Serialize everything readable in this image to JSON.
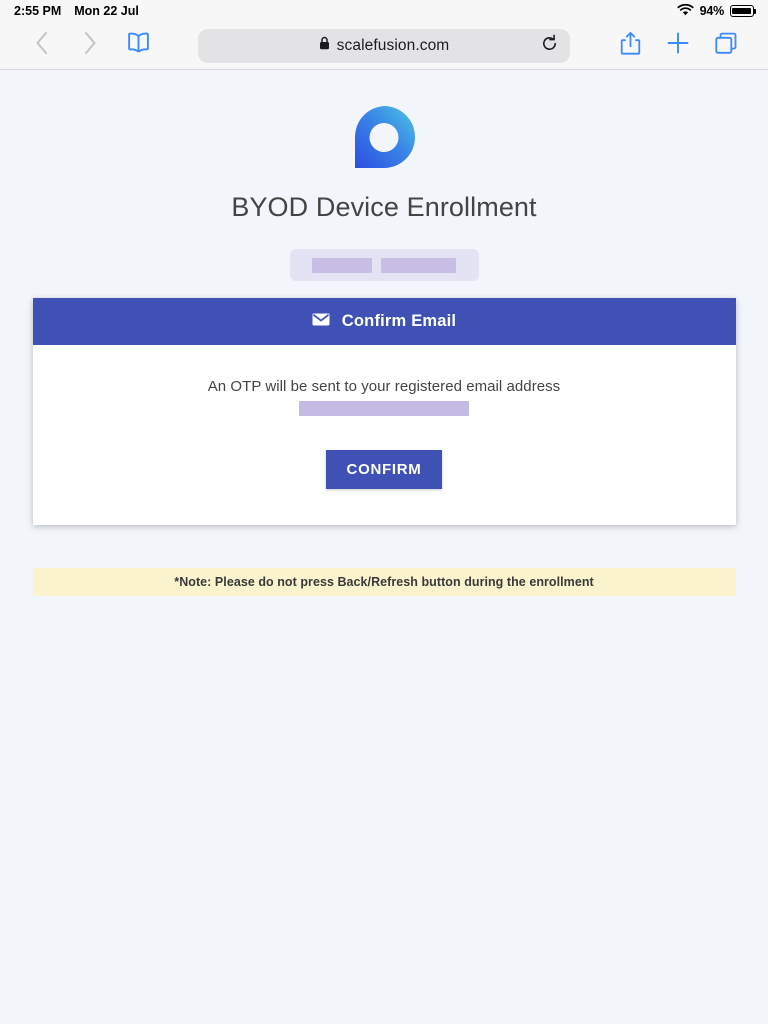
{
  "status_bar": {
    "time": "2:55 PM",
    "date": "Mon 22 Jul",
    "wifi_icon": "wifi-icon",
    "battery_percent": "94%",
    "battery_level": 94,
    "battery_icon": "battery-icon"
  },
  "browser": {
    "back_icon": "chevron-left-icon",
    "forward_icon": "chevron-right-icon",
    "bookmarks_icon": "book-icon",
    "lock_icon": "lock-icon",
    "url": "scalefusion.com",
    "reload_icon": "reload-icon",
    "share_icon": "share-icon",
    "new_tab_icon": "plus-icon",
    "tabs_icon": "tabs-icon",
    "accent_color": "#3b8aff"
  },
  "page": {
    "background_color": "#f2f6fa",
    "logo": {
      "name": "scalefusion-logo",
      "gradient_from": "#2b4fe0",
      "gradient_to": "#4cc8e0"
    },
    "title": "BYOD Device Enrollment",
    "redacted_pill": {
      "container_color": "#e4e3f4",
      "block_color": "#c8bee5",
      "blocks": 2
    },
    "card": {
      "header_color": "#3f51b5",
      "header_icon": "envelope-icon",
      "header_title": "Confirm Email",
      "body_text": "An OTP will be sent to your registered email address",
      "redacted_email_color": "#c3bbe4",
      "confirm_label": "CONFIRM",
      "confirm_color": "#3f51b5"
    },
    "note": {
      "text": "*Note: Please do not press Back/Refresh button during the enrollment",
      "background_color": "#faf3cd"
    }
  }
}
